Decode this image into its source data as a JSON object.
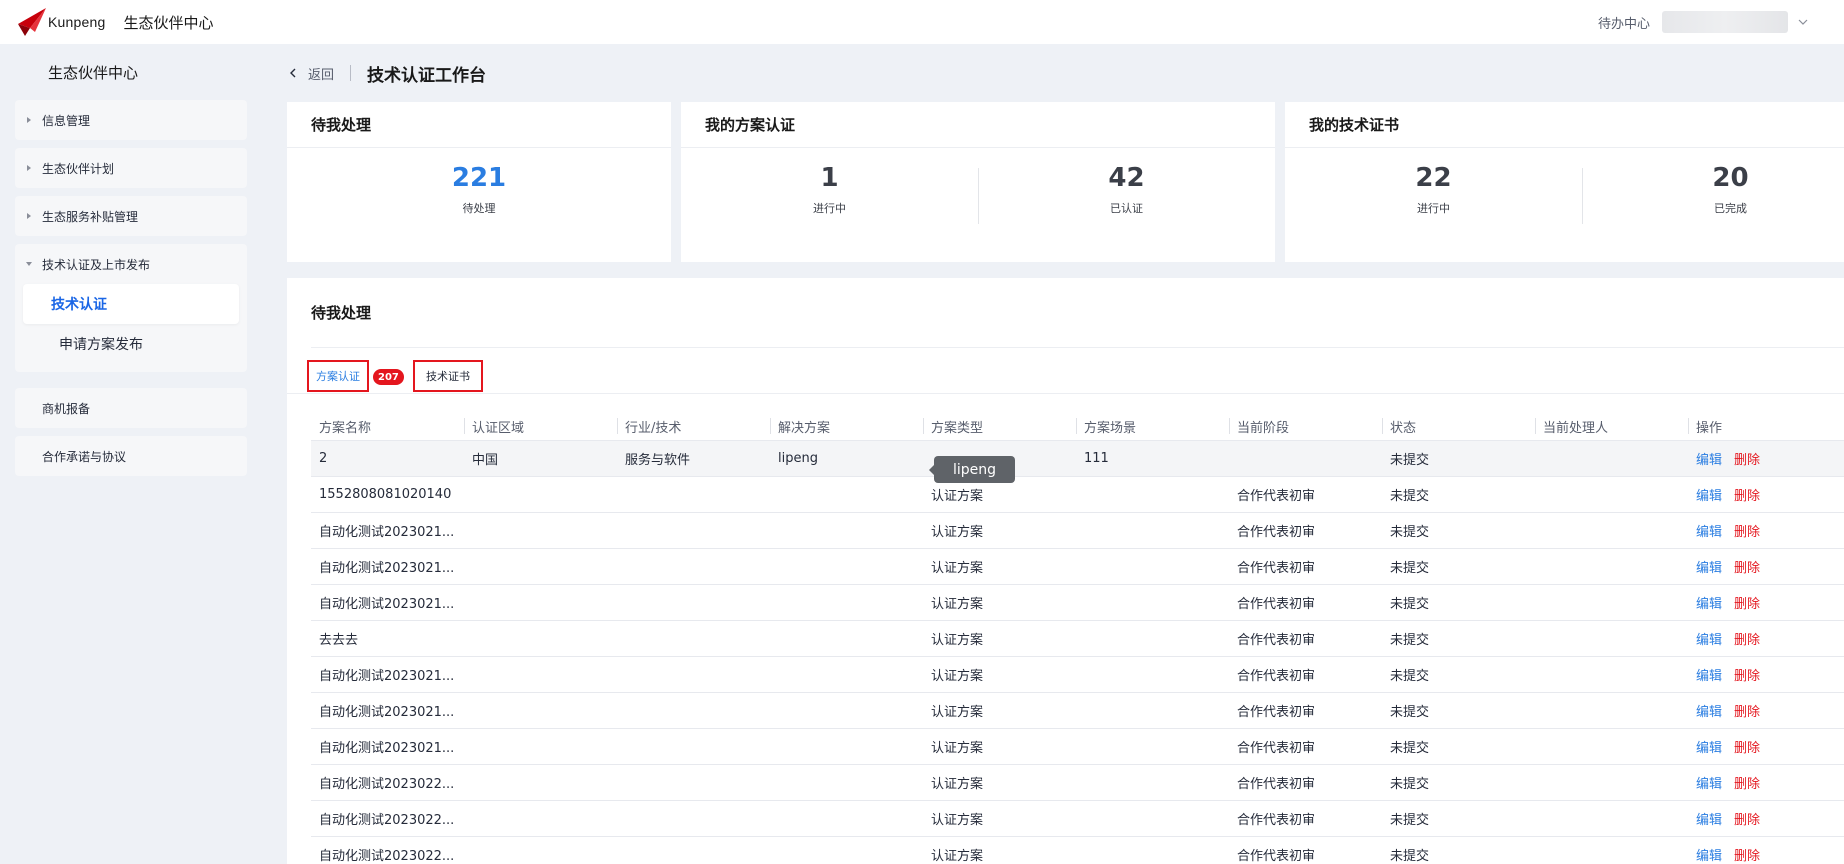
{
  "topbar": {
    "logo_text": "Kunpeng",
    "app_title": "生态伙伴中心",
    "todo_center": "待办中心"
  },
  "sidebar": {
    "title": "生态伙伴中心",
    "groups": [
      {
        "label": "信息管理"
      },
      {
        "label": "生态伙伴计划"
      },
      {
        "label": "生态服务补贴管理"
      },
      {
        "label": "技术认证及上市发布",
        "children": [
          {
            "label": "技术认证"
          },
          {
            "label": "申请方案发布"
          }
        ]
      },
      {
        "label": "商机报备"
      },
      {
        "label": "合作承诺与协议"
      }
    ]
  },
  "breadcrumb": {
    "back": "返回",
    "title": "技术认证工作台"
  },
  "cards": {
    "pending": {
      "title": "待我处理",
      "value": "221",
      "label": "待处理"
    },
    "solutions": {
      "title": "我的方案认证",
      "stats": [
        {
          "value": "1",
          "label": "进行中"
        },
        {
          "value": "42",
          "label": "已认证"
        }
      ]
    },
    "certs": {
      "title": "我的技术证书",
      "stats": [
        {
          "value": "22",
          "label": "进行中"
        },
        {
          "value": "20",
          "label": "已完成"
        }
      ]
    }
  },
  "panel": {
    "title": "待我处理",
    "tabs": [
      {
        "label": "方案认证",
        "badge": "207"
      },
      {
        "label": "技术证书"
      }
    ],
    "columns": [
      "方案名称",
      "认证区域",
      "行业/技术",
      "解决方案",
      "方案类型",
      "方案场景",
      "当前阶段",
      "状态",
      "当前处理人",
      "操作"
    ],
    "actions": {
      "edit": "编辑",
      "delete": "删除"
    },
    "rows": [
      [
        "2",
        "中国",
        "服务与软件",
        "lipeng",
        "",
        "111",
        "",
        "未提交",
        ""
      ],
      [
        "1552808081020140",
        "",
        "",
        "",
        "认证方案",
        "",
        "合作代表初审",
        "未提交",
        ""
      ],
      [
        "自动化测试2023021...",
        "",
        "",
        "",
        "认证方案",
        "",
        "合作代表初审",
        "未提交",
        ""
      ],
      [
        "自动化测试2023021...",
        "",
        "",
        "",
        "认证方案",
        "",
        "合作代表初审",
        "未提交",
        ""
      ],
      [
        "自动化测试2023021...",
        "",
        "",
        "",
        "认证方案",
        "",
        "合作代表初审",
        "未提交",
        ""
      ],
      [
        "去去去",
        "",
        "",
        "",
        "认证方案",
        "",
        "合作代表初审",
        "未提交",
        ""
      ],
      [
        "自动化测试2023021...",
        "",
        "",
        "",
        "认证方案",
        "",
        "合作代表初审",
        "未提交",
        ""
      ],
      [
        "自动化测试2023021...",
        "",
        "",
        "",
        "认证方案",
        "",
        "合作代表初审",
        "未提交",
        ""
      ],
      [
        "自动化测试2023021...",
        "",
        "",
        "",
        "认证方案",
        "",
        "合作代表初审",
        "未提交",
        ""
      ],
      [
        "自动化测试2023022...",
        "",
        "",
        "",
        "认证方案",
        "",
        "合作代表初审",
        "未提交",
        ""
      ],
      [
        "自动化测试2023022...",
        "",
        "",
        "",
        "认证方案",
        "",
        "合作代表初审",
        "未提交",
        ""
      ],
      [
        "自动化测试2023022...",
        "",
        "",
        "",
        "认证方案",
        "",
        "合作代表初审",
        "未提交",
        ""
      ]
    ],
    "tooltip": "lipeng"
  },
  "colors": {
    "accent": "#2a7de1",
    "danger": "#e4161e",
    "logo_red": "#c7000b"
  },
  "icons": {
    "logo": "kunpeng-logo-icon",
    "back": "chevron-left-icon",
    "expand": "caret-right-icon",
    "collapse": "caret-down-icon",
    "user_menu": "chevron-down-icon"
  }
}
